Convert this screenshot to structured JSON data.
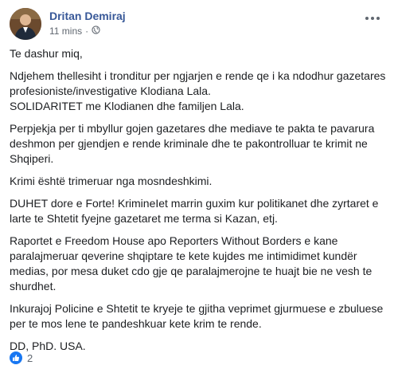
{
  "post": {
    "author": "Dritan Demiraj",
    "time": "11 mins",
    "separator": "·",
    "paragraphs": [
      "Te dashur miq,",
      "Ndjehem thellesiht i tronditur per ngjarjen e rende qe i ka ndodhur gazetares profesioniste/investigative Klodiana Lala.\nSOLIDARITET me Klodianen dhe familjen Lala.",
      "Perpjekja per ti mbyllur gojen gazetares dhe mediave te pakta te pavarura deshmon per gjendjen e rende kriminale dhe te pakontrolluar te krimit ne Shqiperi.",
      "Krimi është trimeruar nga mosndeshkimi.",
      "DUHET dore e Forte! KrimineIet marrin guxim kur politikanet dhe zyrtaret e larte te Shtetit fyejne gazetaret me terma si Kazan, etj.",
      "Raportet e Freedom House apo Reporters Without Borders e kane paralajmeruar qeverine shqiptare te kete kujdes me intimidimet kundër medias, por mesa duket cdo gje qe paralajmerojne te huajt bie ne vesh te shurdhet.",
      "Inkurajoj Policine e Shtetit te kryeje te gjitha veprimet gjurmuese e zbuluese per te mos lene te pandeshkuar kete krim te rende.",
      "DD, PhD. USA."
    ]
  },
  "reactions": {
    "count": "2",
    "icon": "like-icon",
    "color": "#1877f2"
  },
  "icons": {
    "privacy": "globe-icon",
    "menu": "more-options-icon"
  }
}
